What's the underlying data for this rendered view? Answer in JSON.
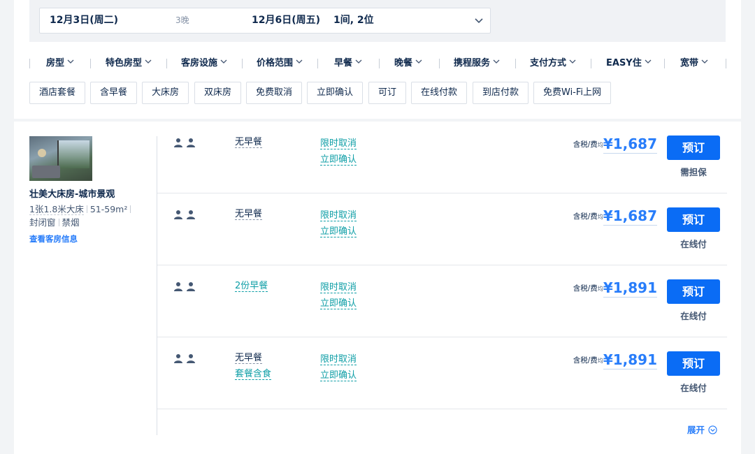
{
  "search": {
    "checkin": "12月3日(周二)",
    "nights": "3晚",
    "checkout": "12月6日(周五)",
    "rooms_guests": "1间, 2位"
  },
  "filters": [
    "房型",
    "特色房型",
    "客房设施",
    "价格范围",
    "早餐",
    "晚餐",
    "携程服务",
    "支付方式",
    "EASY住",
    "宽带"
  ],
  "chips": [
    "酒店套餐",
    "含早餐",
    "大床房",
    "双床房",
    "免费取消",
    "立即确认",
    "可订",
    "在线付款",
    "到店付款",
    "免费Wi-Fi上网"
  ],
  "room": {
    "name": "壮美大床房-城市景观",
    "bed": "1张1.8米大床",
    "area": "51-59m²",
    "window": "封闭窗",
    "smoking": "禁烟",
    "link": "查看客房信息"
  },
  "rates": [
    {
      "meal": "无早餐",
      "meal_extra": "",
      "cancel": "限时取消",
      "confirm": "立即确认",
      "tax_label": "含税/费",
      "tax_suffix": "均",
      "price": "¥1,687",
      "book": "预订",
      "note": "需担保"
    },
    {
      "meal": "无早餐",
      "meal_extra": "",
      "cancel": "限时取消",
      "confirm": "立即确认",
      "tax_label": "含税/费",
      "tax_suffix": "均",
      "price": "¥1,687",
      "book": "预订",
      "note": "在线付"
    },
    {
      "meal": "2份早餐",
      "meal_extra": "",
      "cancel": "限时取消",
      "confirm": "立即确认",
      "tax_label": "含税/费",
      "tax_suffix": "均",
      "price": "¥1,891",
      "book": "预订",
      "note": "在线付"
    },
    {
      "meal": "无早餐",
      "meal_extra": "套餐含食",
      "cancel": "限时取消",
      "confirm": "立即确认",
      "tax_label": "含税/费",
      "tax_suffix": "均",
      "price": "¥1,891",
      "book": "预订",
      "note": "在线付"
    }
  ],
  "expand_label": "展开",
  "colors": {
    "accent": "#287dfa",
    "button": "#0a6cf5",
    "teal": "#0e9ea6",
    "text": "#0f294d"
  }
}
